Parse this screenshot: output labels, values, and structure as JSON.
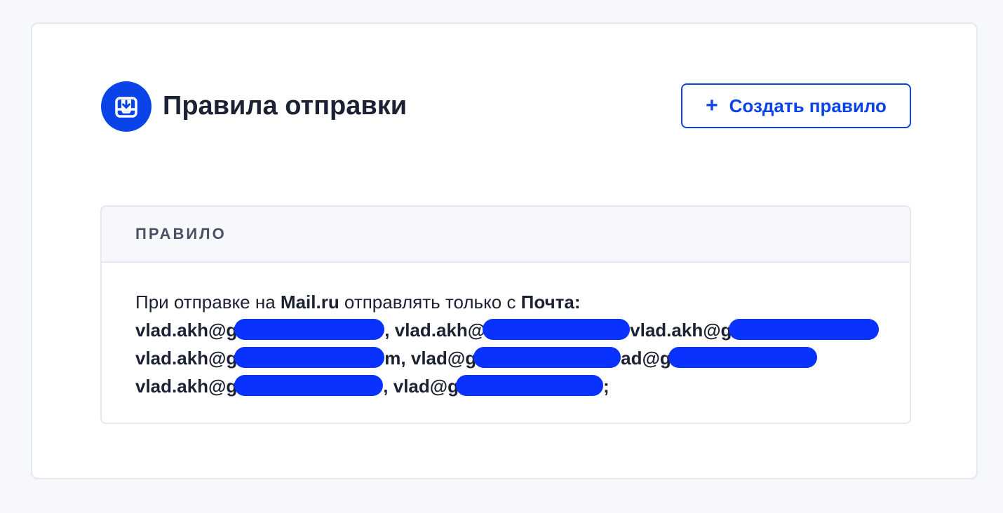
{
  "header": {
    "title": "Правила отправки",
    "icon": "inbox-download-icon",
    "accent_color": "#0a44e8"
  },
  "toolbar": {
    "create_plus": "+",
    "create_label": "Создать правило"
  },
  "table": {
    "column_header": "ПРАВИЛО",
    "row": {
      "prefix": "При отправке на ",
      "domain": "Mail.ru",
      "middle": " отправлять только с ",
      "sender_label": "Почта:",
      "line2": {
        "a": "vlad.akh@g",
        "b": ", vlad.akh@",
        "c": "vlad.akh@g"
      },
      "line3": {
        "a": "vlad.akh@g",
        "b": "m, vlad@g",
        "c": "ad@g"
      },
      "line4": {
        "a": "vlad.akh@g",
        "b": ", vlad@g",
        "c": ";"
      },
      "redaction_color": "#0a32ff"
    }
  }
}
